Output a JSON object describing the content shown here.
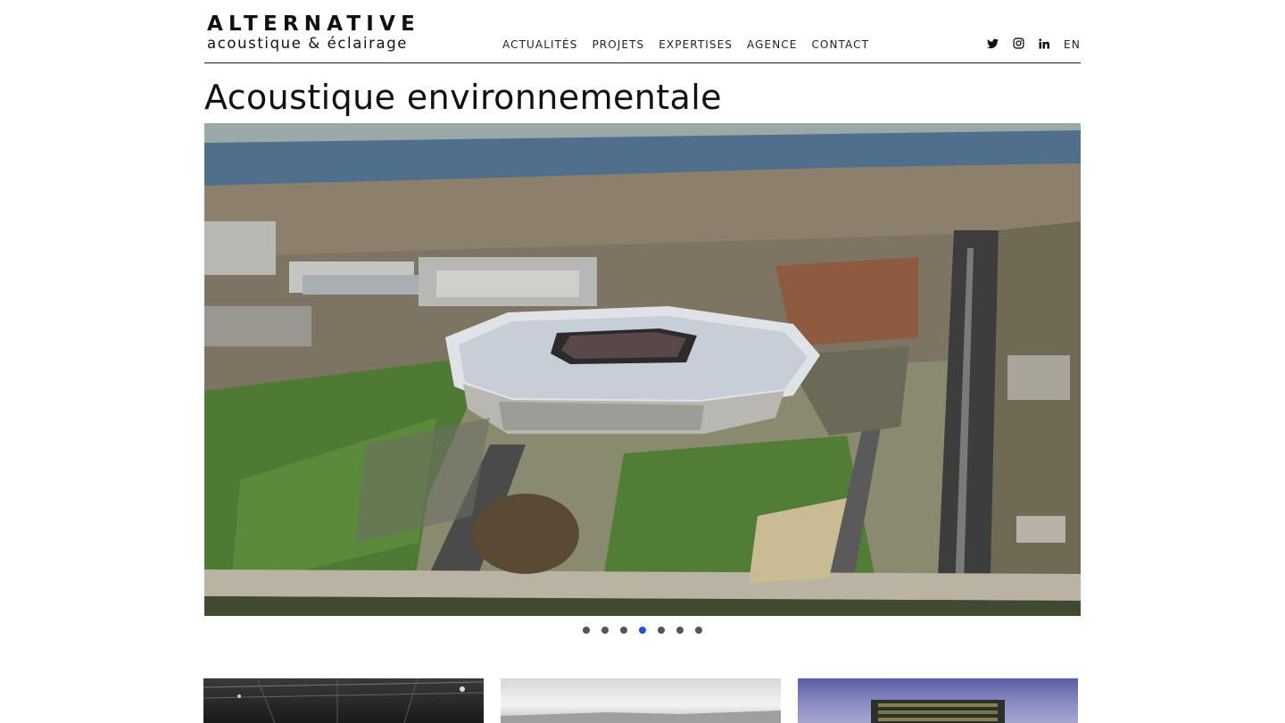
{
  "brand": {
    "title": "ALTERNATIVE",
    "subtitle": "acoustique & éclairage"
  },
  "nav": {
    "items": [
      "ACTUALITÉS",
      "PROJETS",
      "EXPERTISES",
      "AGENCE",
      "CONTACT"
    ]
  },
  "social": {
    "icons": [
      "twitter-icon",
      "instagram-icon",
      "linkedin-icon"
    ],
    "lang": "EN"
  },
  "page": {
    "title": "Acoustique environnementale"
  },
  "slider": {
    "slide_count": 7,
    "active_index": 3,
    "active_color": "#1f56c6",
    "dot_color": "#555555"
  },
  "thumbnails": {
    "count": 3
  }
}
